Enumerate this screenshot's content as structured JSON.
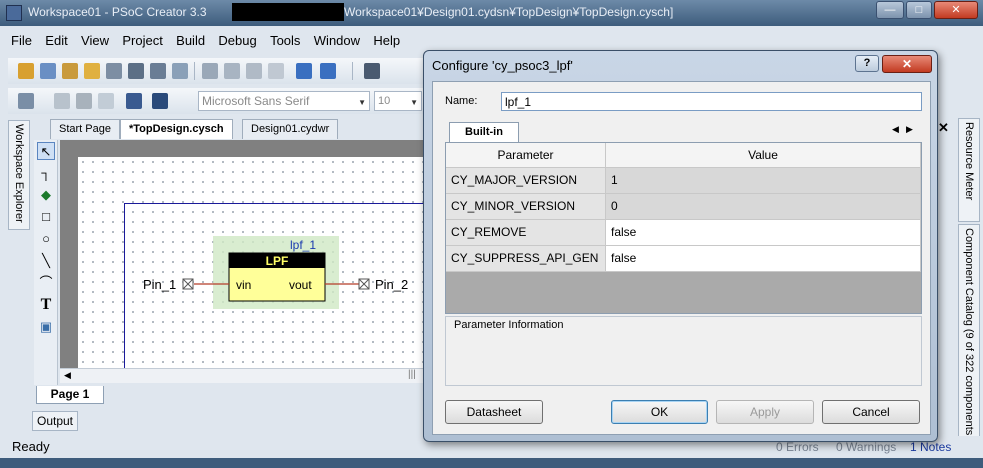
{
  "window": {
    "title_prefix": "Workspace01 - PSoC Creator 3.3",
    "title_path": "Workspace01¥Design01.cydsn¥TopDesign¥TopDesign.cysch]",
    "min_glyph": "—",
    "max_glyph": "□",
    "close_glyph": "✕"
  },
  "menu": [
    "File",
    "Edit",
    "View",
    "Project",
    "Build",
    "Debug",
    "Tools",
    "Window",
    "Help"
  ],
  "toolbar": {
    "font_name": "Microsoft Sans Serif",
    "font_size": "10"
  },
  "left_panel": {
    "workspace_explorer": "Workspace Explorer"
  },
  "tabs": {
    "start_page": "Start Page",
    "top_design": "*TopDesign.cysch",
    "design_wide": "Design01.cydwr"
  },
  "schematic": {
    "instance_label": "lpf_1",
    "component_title": "LPF",
    "pin_in": "vin",
    "pin_out": "vout",
    "input_pin_label": "Pin_1",
    "output_pin_label": "Pin_2"
  },
  "page_tab": "Page 1",
  "output_tab": "Output",
  "status": {
    "ready": "Ready",
    "errors": "0 Errors",
    "warnings": "0 Warnings",
    "notes": "1 Notes"
  },
  "right_panel": {
    "resource_meter": "Resource Meter",
    "component_catalog": "Component Catalog (9 of 322 components"
  },
  "dialog": {
    "title": "Configure 'cy_psoc3_lpf'",
    "help_glyph": "?",
    "close_glyph": "✕",
    "name_label": "Name:",
    "name_value": "lpf_1",
    "tab_label": "Built-in",
    "columns": [
      "Parameter",
      "Value"
    ],
    "rows": [
      {
        "name": "CY_MAJOR_VERSION",
        "value": "1",
        "editable": false
      },
      {
        "name": "CY_MINOR_VERSION",
        "value": "0",
        "editable": false
      },
      {
        "name": "CY_REMOVE",
        "value": "false",
        "editable": true
      },
      {
        "name": "CY_SUPPRESS_API_GEN",
        "value": "false",
        "editable": true
      }
    ],
    "param_info_title": "Parameter Information",
    "buttons": {
      "datasheet": "Datasheet",
      "ok": "OK",
      "apply": "Apply",
      "cancel": "Cancel"
    }
  }
}
